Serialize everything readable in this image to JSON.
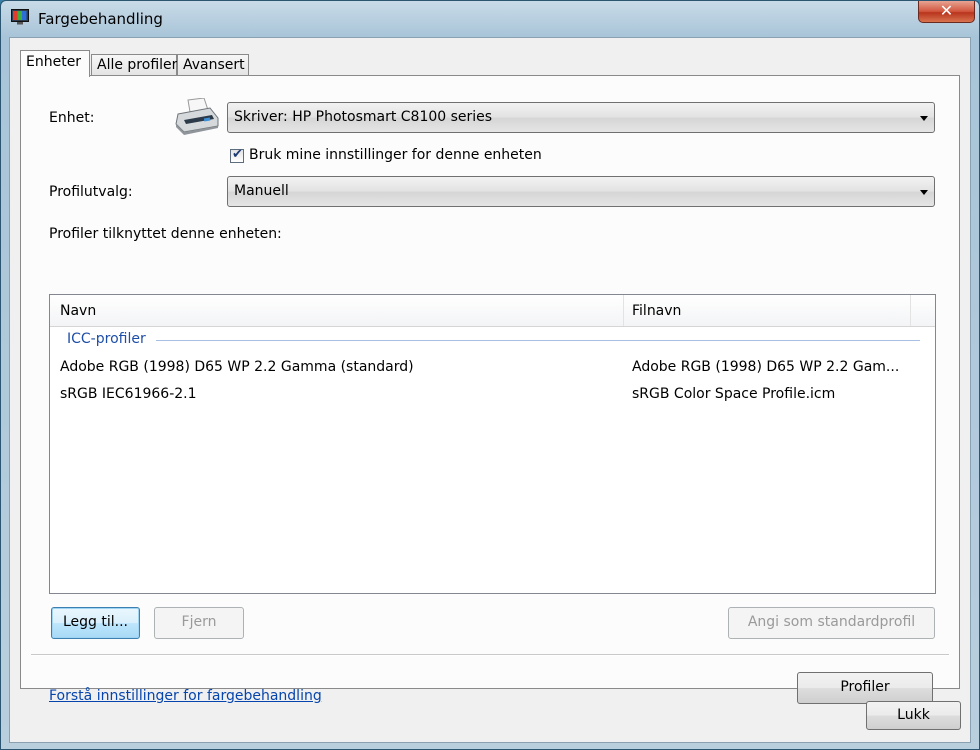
{
  "window": {
    "title": "Fargebehandling",
    "close_glyph": "✕",
    "icon": "color-management-icon"
  },
  "tabs": [
    {
      "label": "Enheter",
      "active": true
    },
    {
      "label": "Alle profiler",
      "active": false
    },
    {
      "label": "Avansert",
      "active": false
    }
  ],
  "device": {
    "label": "Enhet:",
    "icon": "printer-icon",
    "selected": "Skriver: HP Photosmart C8100 series"
  },
  "use_my_settings": {
    "label": "Bruk mine innstillinger for denne enheten",
    "checked": true
  },
  "profile_selection": {
    "label": "Profilutvalg:",
    "selected": "Manuell"
  },
  "profiles_section": {
    "label": "Profiler tilknyttet denne enheten:",
    "columns": [
      "Navn",
      "Filnavn"
    ],
    "group": "ICC-profiler",
    "rows": [
      {
        "name": "Adobe RGB (1998) D65 WP 2.2 Gamma (standard)",
        "file": "Adobe RGB (1998) D65 WP 2.2 Gam..."
      },
      {
        "name": "sRGB IEC61966-2.1",
        "file": "sRGB Color Space Profile.icm"
      }
    ]
  },
  "buttons": {
    "add": "Legg til...",
    "remove": "Fjern",
    "set_default": "Angi som standardprofil",
    "profiles": "Profiler",
    "close": "Lukk"
  },
  "link": "Forstå innstillinger for fargebehandling",
  "colors": {
    "accent": "#1e4fa8",
    "link": "#0645ad",
    "window_frame": "#a8c4d8",
    "close_button": "#c8452c"
  }
}
